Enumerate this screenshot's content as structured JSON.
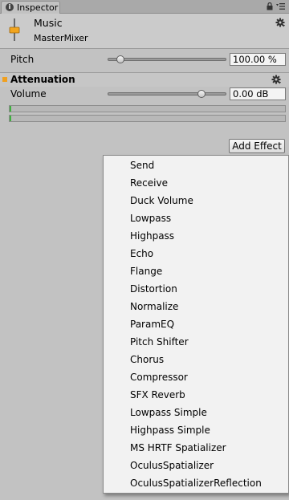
{
  "tab": {
    "label": "Inspector",
    "info_glyph": "i",
    "icons": [
      "lock-icon",
      "menu-icon"
    ]
  },
  "header": {
    "title": "Music",
    "subtitle": "MasterMixer",
    "icon": "audio-mixer-fader-icon"
  },
  "pitch": {
    "label": "Pitch",
    "value": "100.00 %",
    "slider_fraction": 0.11
  },
  "attenuation": {
    "title": "Attenuation",
    "volume_label": "Volume",
    "volume_value": "0.00 dB",
    "volume_fraction": 0.79,
    "meters": [
      0.005,
      0.005
    ]
  },
  "add_effect_label": "Add Effect",
  "menu_items": [
    "Send",
    "Receive",
    "Duck Volume",
    "Lowpass",
    "Highpass",
    "Echo",
    "Flange",
    "Distortion",
    "Normalize",
    "ParamEQ",
    "Pitch Shifter",
    "Chorus",
    "Compressor",
    "SFX Reverb",
    "Lowpass Simple",
    "Highpass Simple",
    "MS HRTF Spatializer",
    "OculusSpatializer",
    "OculusSpatializerReflection"
  ],
  "colors": {
    "accent": "#f0a020",
    "meter": "#3fb03f",
    "panel": "#c2c2c2",
    "menu_bg": "#f2f2f2"
  }
}
